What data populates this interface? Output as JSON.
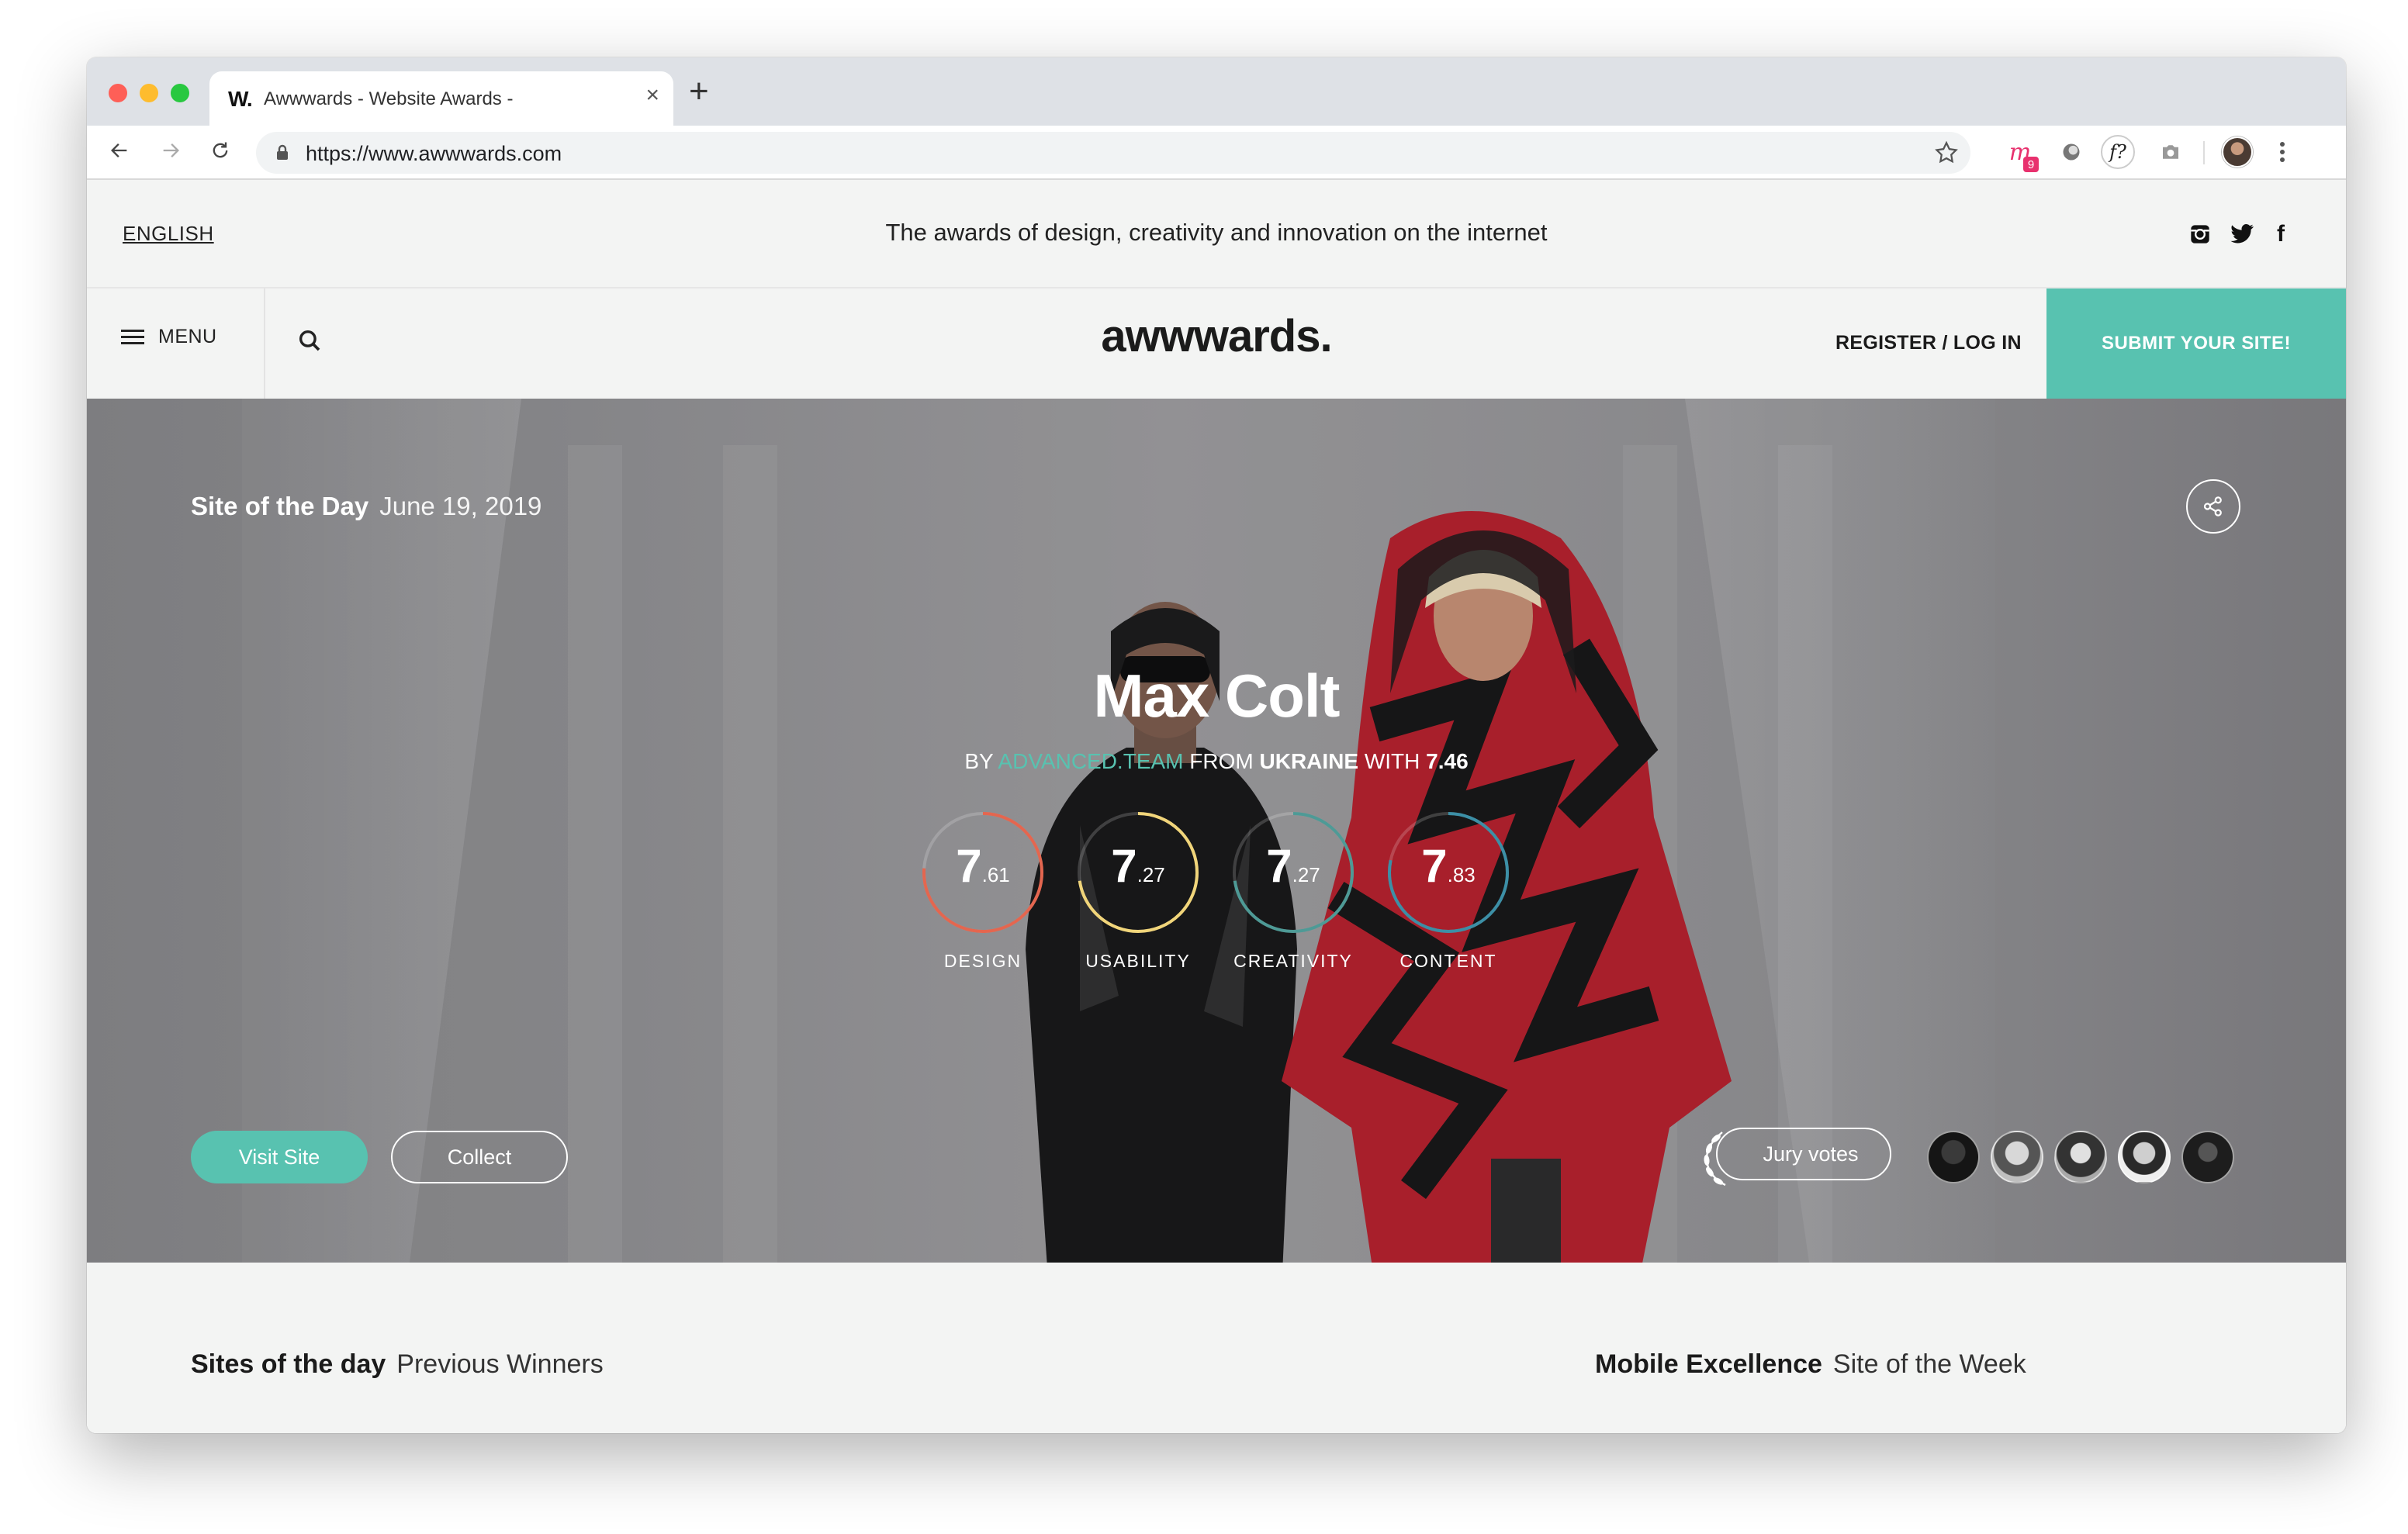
{
  "browser": {
    "tab": {
      "favicon_text": "W.",
      "title": "Awwwards - Website Awards -",
      "close": "×"
    },
    "new_tab": "+",
    "url": "https://www.awwwards.com",
    "extensions": {
      "m_badge": "9",
      "f_label": "f?"
    }
  },
  "topbar": {
    "language": "ENGLISH",
    "tagline": "The awards of design, creativity and innovation on the internet",
    "social": {
      "facebook": "f"
    }
  },
  "nav": {
    "menu_label": "MENU",
    "logo": "awwwards.",
    "register_label": "REGISTER / LOG IN",
    "submit_label": "SUBMIT YOUR SITE!"
  },
  "hero": {
    "badge_label": "Site of the Day",
    "date": "June 19, 2019",
    "site_name": "Max Colt",
    "byline": {
      "by": "BY",
      "team": "ADVANCED.TEAM",
      "from": "FROM",
      "country": "UKRAINE",
      "with": "WITH",
      "score": "7.46"
    },
    "scores": [
      {
        "label": "DESIGN",
        "int": "7",
        "dec": ".61",
        "value": 7.61,
        "color": "#e4664f"
      },
      {
        "label": "USABILITY",
        "int": "7",
        "dec": ".27",
        "value": 7.27,
        "color": "#f1d57a"
      },
      {
        "label": "CREATIVITY",
        "int": "7",
        "dec": ".27",
        "value": 7.27,
        "color": "#4e9a96"
      },
      {
        "label": "CONTENT",
        "int": "7",
        "dec": ".83",
        "value": 7.83,
        "color": "#3c8fa6"
      }
    ],
    "visit_label": "Visit Site",
    "collect_label": "Collect",
    "jury_label": "Jury votes"
  },
  "sections": {
    "left_title": "Sites of the day",
    "left_sub": "Previous Winners",
    "right_title": "Mobile Excellence",
    "right_sub": "Site of the Week"
  },
  "colors": {
    "accent": "#58c2b0"
  }
}
